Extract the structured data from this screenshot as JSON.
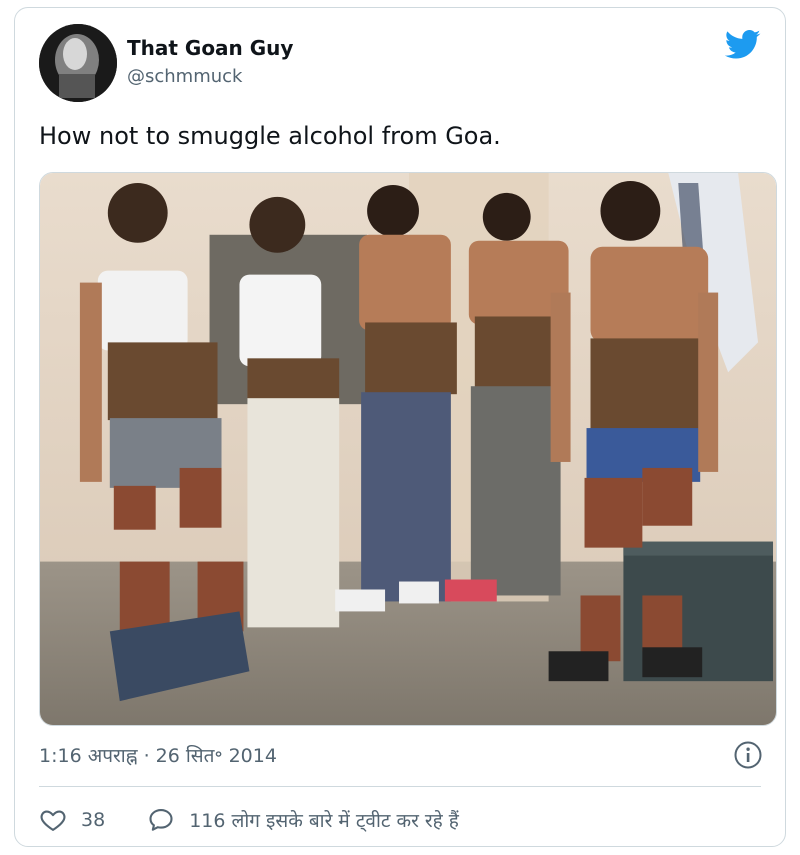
{
  "author": {
    "name": "That Goan Guy",
    "handle": "@schmmuck"
  },
  "brand": {
    "icon": "twitter-bird-icon",
    "color": "#1d9bf0"
  },
  "tweet": {
    "text": "How not to smuggle alcohol from Goa.",
    "timestamp": "1:16 अपराह्न · 26 सित॰ 2014"
  },
  "actions": {
    "like_icon": "heart-icon",
    "like_count": "38",
    "reply_icon": "speech-bubble-icon",
    "discussion_text": "116 लोग इसके बारे में ट्वीट कर रहे हैं"
  },
  "info_icon": "info-icon",
  "colors": {
    "text_primary": "#0f1419",
    "text_secondary": "#536471",
    "border": "#cfd9de"
  }
}
